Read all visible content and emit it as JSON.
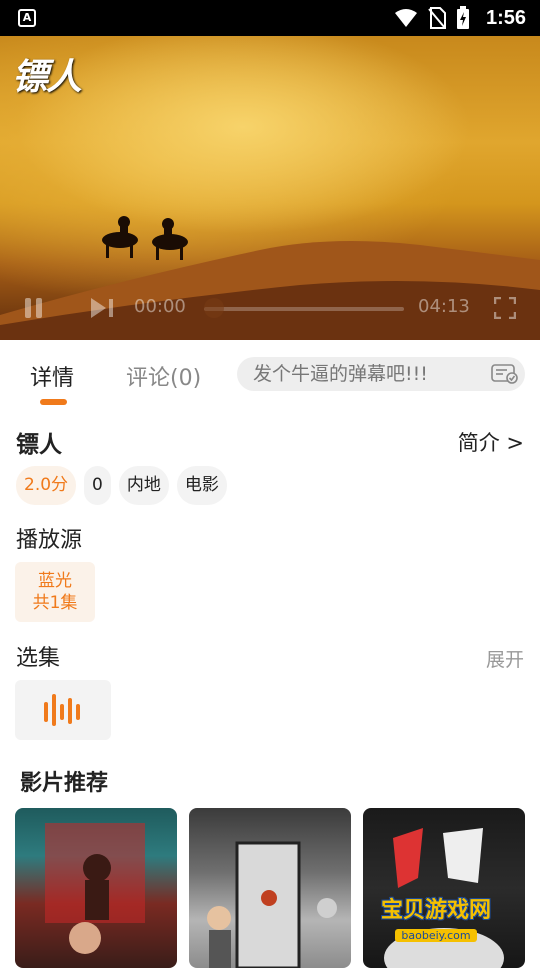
{
  "status_bar": {
    "time": "1:56"
  },
  "player": {
    "logo_text": "镖人",
    "current_time": "00:00",
    "duration": "04:13",
    "progress": 0
  },
  "tabs": {
    "detail": "详情",
    "comment": "评论(0)"
  },
  "danmu": {
    "placeholder": "发个牛逼的弹幕吧!!!"
  },
  "movie": {
    "title": "镖人",
    "intro_link": "简介 >",
    "chips": {
      "rating": "2.0分",
      "count": "0",
      "region": "内地",
      "type": "电影"
    }
  },
  "source": {
    "heading": "播放源",
    "name": "蓝光",
    "episodes": "共1集"
  },
  "episodes": {
    "heading": "选集",
    "expand": "展开"
  },
  "recommend": {
    "heading": "影片推荐"
  },
  "watermark": {
    "main": "宝贝游戏网",
    "url": "baobeiy.com"
  },
  "colors": {
    "accent": "#f07a1b",
    "accent_bg": "#fbf2e9",
    "chip_bg": "#f3f3f3"
  }
}
